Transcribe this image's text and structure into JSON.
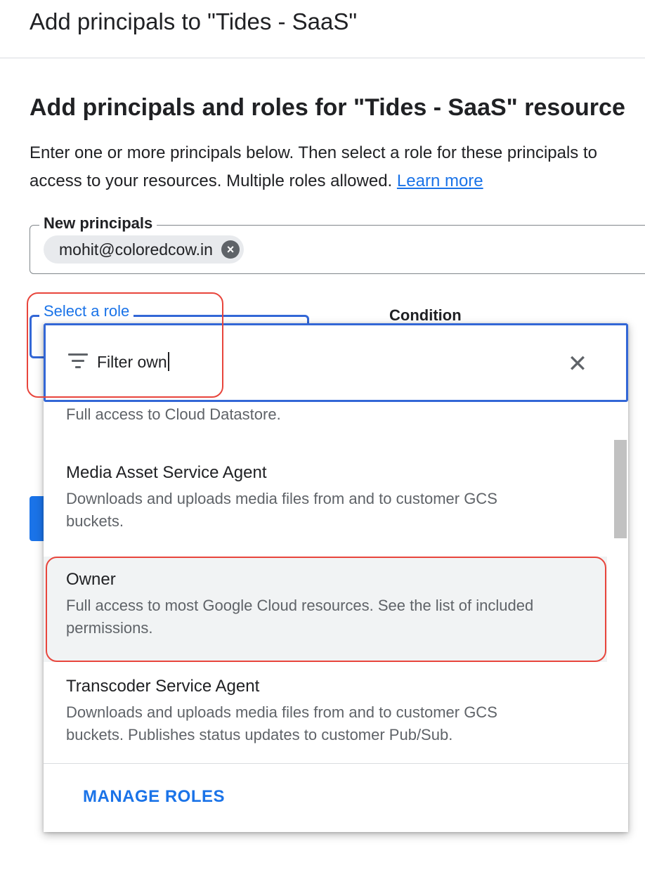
{
  "dialog": {
    "title": "Add principals to \"Tides - SaaS\"",
    "heading": "Add principals and roles for \"Tides - SaaS\" resource",
    "description_line1": "Enter one or more principals below. Then select a role for these principals to",
    "description_line2": "access to your resources. Multiple roles allowed.",
    "learn_more": "Learn more"
  },
  "principals": {
    "label": "New principals",
    "chips": [
      {
        "email": "mohit@coloredcow.in",
        "remove_icon": "close-circle-icon"
      }
    ]
  },
  "role": {
    "label": "Select a role",
    "condition_label": "Condition"
  },
  "role_dropdown": {
    "filter_value": "Filter own",
    "filter_icon": "filter-lines-icon",
    "clear_icon": "close-icon",
    "options": [
      {
        "title": "",
        "description": "Full access to Cloud Datastore."
      },
      {
        "title": "Media Asset Service Agent",
        "description_line1": "Downloads and uploads media files from and to customer GCS",
        "description_line2": "buckets."
      },
      {
        "title": "Owner",
        "description_line1": "Full access to most Google Cloud resources. See the list of included",
        "description_line2": "permissions.",
        "highlighted": true
      },
      {
        "title": "Transcoder Service Agent",
        "description_line1": "Downloads and uploads media files from and to customer GCS",
        "description_line2": "buckets. Publishes status updates to customer Pub/Sub."
      }
    ],
    "manage_roles": "MANAGE ROLES"
  },
  "colors": {
    "accent": "#1a73e8",
    "focus_border": "#3367d6",
    "annotation_highlight": "#e8453c"
  }
}
